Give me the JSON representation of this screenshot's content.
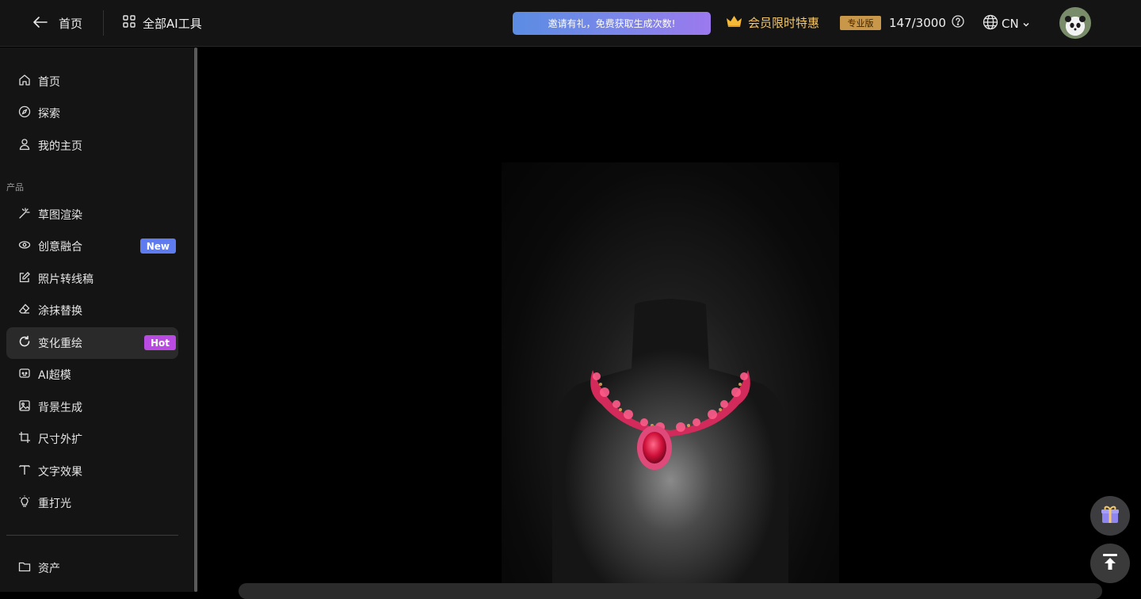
{
  "header": {
    "back_label": "首页",
    "all_tools_label": "全部AI工具",
    "invite_text": "邀请有礼，免费获取生成次数!",
    "vip_text": "会员限时特惠",
    "plan_badge": "专业版",
    "quota": "147/3000",
    "language": "CN"
  },
  "sidebar": {
    "top_items": [
      {
        "label": "首页",
        "icon": "home-icon"
      },
      {
        "label": "探索",
        "icon": "compass-icon"
      },
      {
        "label": "我的主页",
        "icon": "user-icon"
      }
    ],
    "section_label": "产品",
    "product_items": [
      {
        "label": "草图渲染",
        "icon": "magic-wand-icon"
      },
      {
        "label": "创意融合",
        "icon": "blend-icon",
        "badge": "New"
      },
      {
        "label": "照片转线稿",
        "icon": "edit-square-icon"
      },
      {
        "label": "涂抹替换",
        "icon": "eraser-icon"
      },
      {
        "label": "变化重绘",
        "icon": "refresh-icon",
        "badge": "Hot",
        "active": true
      },
      {
        "label": "AI超模",
        "icon": "robot-icon"
      },
      {
        "label": "背景生成",
        "icon": "image-icon"
      },
      {
        "label": "尺寸外扩",
        "icon": "crop-icon"
      },
      {
        "label": "文字效果",
        "icon": "text-icon"
      },
      {
        "label": "重打光",
        "icon": "lightbulb-icon"
      }
    ],
    "bottom_items": [
      {
        "label": "资产",
        "icon": "folder-icon"
      }
    ]
  },
  "colors": {
    "accent_new": "#5e7bf0",
    "accent_hot": "#b94be3",
    "vip_gold": "#f5c86a"
  }
}
